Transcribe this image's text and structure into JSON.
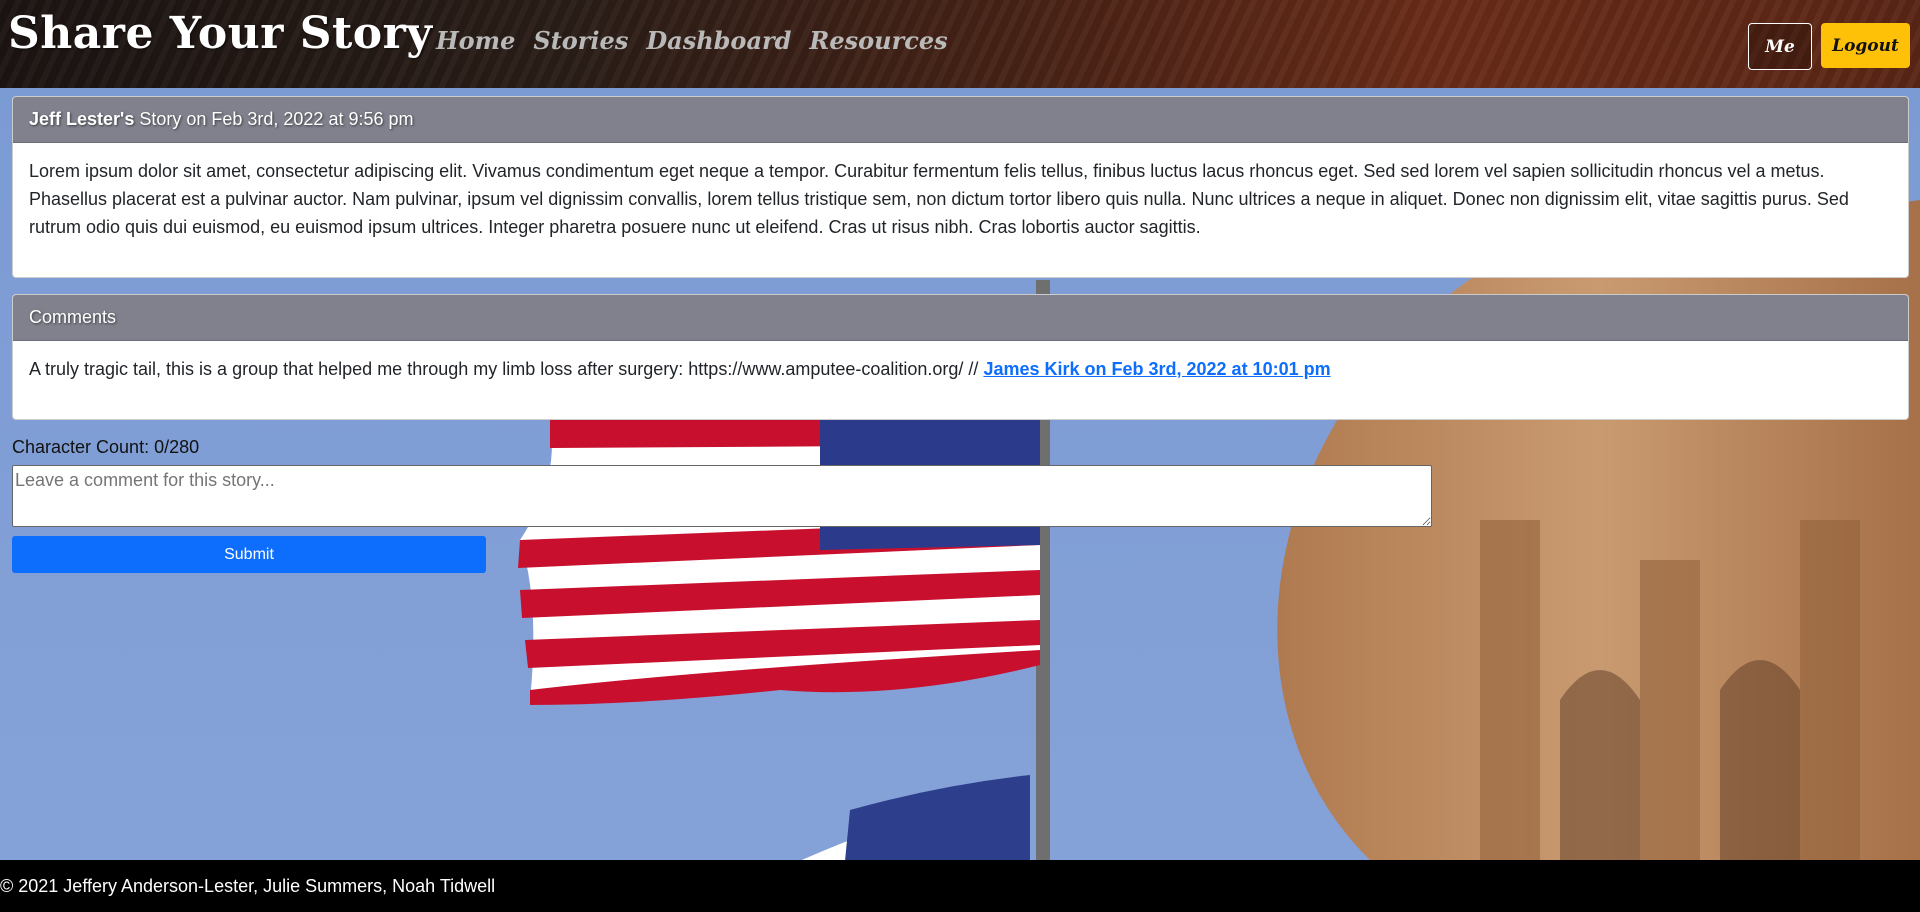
{
  "header": {
    "brand": "Share Your Story",
    "nav": [
      {
        "label": "Home"
      },
      {
        "label": "Stories"
      },
      {
        "label": "Dashboard"
      },
      {
        "label": "Resources"
      }
    ],
    "me_label": "Me",
    "logout_label": "Logout"
  },
  "story": {
    "author": "Jeff Lester's",
    "meta": "Story on Feb 3rd, 2022 at 9:56 pm",
    "body": "Lorem ipsum dolor sit amet, consectetur adipiscing elit. Vivamus condimentum eget neque a tempor. Curabitur fermentum felis tellus, finibus luctus lacus rhoncus eget. Sed sed lorem vel sapien sollicitudin rhoncus vel a metus. Phasellus placerat est a pulvinar auctor. Nam pulvinar, ipsum vel dignissim convallis, lorem tellus tristique sem, non dictum tortor libero quis nulla. Nunc ultrices a neque in aliquet. Donec non dignissim elit, vitae sagittis purus. Sed rutrum odio quis dui euismod, eu euismod ipsum ultrices. Integer pharetra posuere nunc ut eleifend. Cras ut risus nibh. Cras lobortis auctor sagittis."
  },
  "comments": {
    "title": "Comments",
    "items": [
      {
        "text": "A truly tragic tail, this is a group that helped me through my limb loss after surgery: https://www.amputee-coalition.org/ // ",
        "byline": "James Kirk on Feb 3rd, 2022 at 10:01 pm"
      }
    ]
  },
  "comment_form": {
    "char_count": "Character Count: 0/280",
    "placeholder": "Leave a comment for this story...",
    "submit_label": "Submit"
  },
  "footer": {
    "text": "© 2021 Jeffery Anderson-Lester, Julie Summers, Noah Tidwell"
  },
  "colors": {
    "accent": "#0d6efd",
    "logout": "#ffc107",
    "card_header": "#81818d"
  }
}
